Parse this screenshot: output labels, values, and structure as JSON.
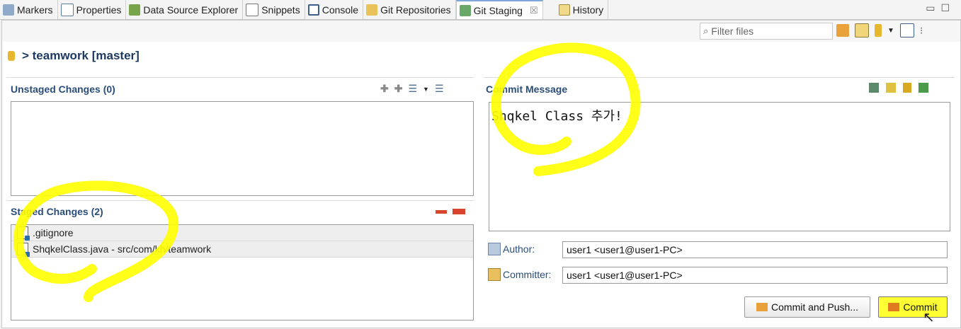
{
  "tabs": [
    {
      "label": "Markers",
      "icon": "markers-icon"
    },
    {
      "label": "Properties",
      "icon": "properties-icon"
    },
    {
      "label": "Data Source Explorer",
      "icon": "data-source-icon"
    },
    {
      "label": "Snippets",
      "icon": "snippets-icon"
    },
    {
      "label": "Console",
      "icon": "console-icon"
    },
    {
      "label": "Git Repositories",
      "icon": "git-repositories-icon"
    },
    {
      "label": "Git Staging",
      "icon": "git-staging-icon",
      "close": "☒"
    },
    {
      "label": "History",
      "icon": "history-icon"
    }
  ],
  "window_controls": {
    "minimize": "▭",
    "maximize": "☐"
  },
  "filter": {
    "placeholder": "Filter files",
    "icon": "search-icon"
  },
  "repo": {
    "title": "> teamwork [master]"
  },
  "unstaged": {
    "title": "Unstaged Changes (0)"
  },
  "staged": {
    "title": "Staged Changes (2)",
    "files": [
      {
        "name": ".gitignore"
      },
      {
        "name": "ShqkelClass.java - src/com/kh/teamwork"
      }
    ]
  },
  "commit": {
    "title": "Commit Message",
    "message": "Shqkel Class 추가!",
    "author_label": "Author:",
    "author_value": "user1 <user1@user1-PC>",
    "committer_label": "Committer:",
    "committer_value": "user1 <user1@user1-PC>",
    "commit_push_label": "Commit and Push...",
    "commit_label": "Commit"
  },
  "colors": {
    "highlight": "#ffff00",
    "section_title": "#2a4d7a",
    "remove_red": "#d9442e"
  }
}
